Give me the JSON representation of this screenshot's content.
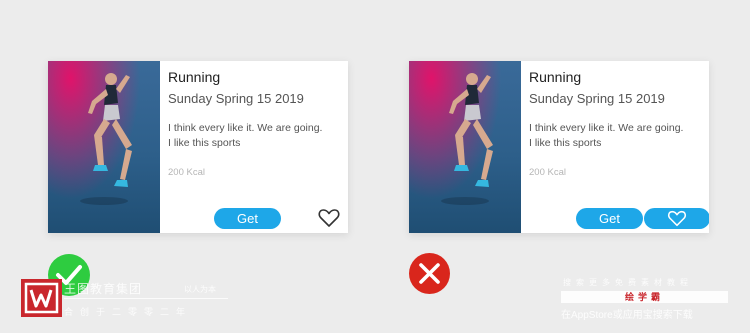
{
  "cards": [
    {
      "title": "Running",
      "date": "Sunday Spring 15 2019",
      "desc_line1": "I think every like it. We are going.",
      "desc_line2": "I like this sports",
      "kcal": "200 Kcal",
      "get_label": "Get",
      "heart_style": "plain-icon"
    },
    {
      "title": "Running",
      "date": "Sunday Spring 15 2019",
      "desc_line1": "I think every like it. We are going.",
      "desc_line2": "I like this sports",
      "kcal": "200 Kcal",
      "get_label": "Get",
      "heart_style": "filled-pill-button"
    }
  ],
  "verdicts": {
    "left": {
      "icon": "check-icon",
      "color": "#2ecc40"
    },
    "right": {
      "icon": "cross-icon",
      "color": "#d9261c"
    }
  },
  "colors": {
    "accent": "#1ea7e8",
    "card_bg": "#ffffff",
    "page_bg": "#ececec"
  },
  "watermark": {
    "left_line1": "王图教育集团",
    "left_line1_small": "以人为本",
    "left_line2": "合创于二零零二年",
    "right_line1": "搜索更多免费素材教程",
    "right_bar": "绘学霸",
    "right_line2": "在AppStore或应用宝搜索下载"
  }
}
